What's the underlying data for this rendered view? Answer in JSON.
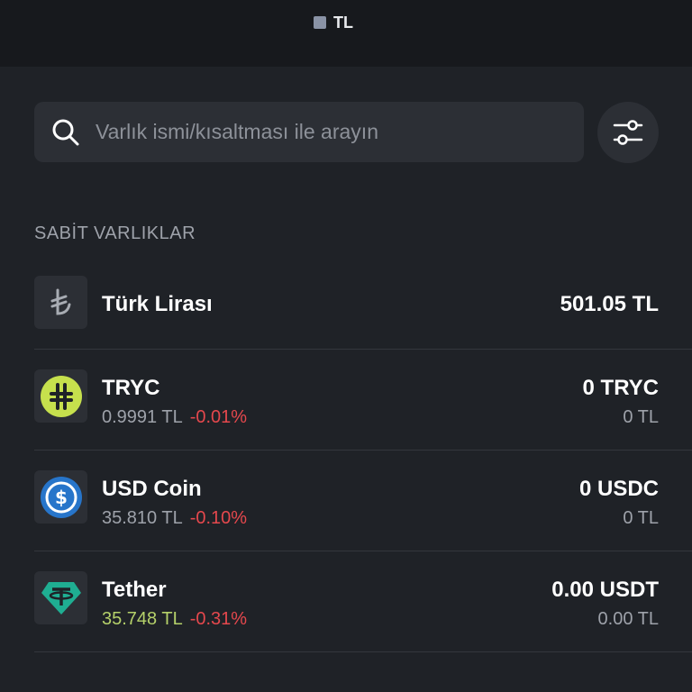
{
  "header": {
    "currency_label": "TL",
    "currency_color": "#8a93a6"
  },
  "search": {
    "placeholder": "Varlık ismi/kısaltması ile arayın",
    "value": "",
    "icon": "search-icon"
  },
  "filter": {
    "icon": "sliders-icon"
  },
  "section": {
    "title": "SABİT VARLIKLAR"
  },
  "assets": [
    {
      "name": "Türk Lirası",
      "icon": "lira-icon",
      "balance": "501.05 TL"
    },
    {
      "name": "TRYC",
      "icon": "tryc-icon",
      "icon_color": "#c6e04d",
      "price": "0.9991 TL",
      "change": "-0.01%",
      "balance": "0 TRYC",
      "balance_fiat": "0 TL"
    },
    {
      "name": "USD Coin",
      "icon": "usdc-icon",
      "icon_color": "#2775ca",
      "price": "35.810 TL",
      "change": "-0.10%",
      "balance": "0 USDC",
      "balance_fiat": "0 TL"
    },
    {
      "name": "Tether",
      "icon": "tether-icon",
      "icon_color": "#1fae92",
      "price": "35.748 TL",
      "change": "-0.31%",
      "balance": "0.00 USDT",
      "balance_fiat": "0.00 TL"
    }
  ],
  "colors": {
    "background": "#1f2227",
    "negative": "#e5484d",
    "positive_price": "#b5d16a"
  }
}
